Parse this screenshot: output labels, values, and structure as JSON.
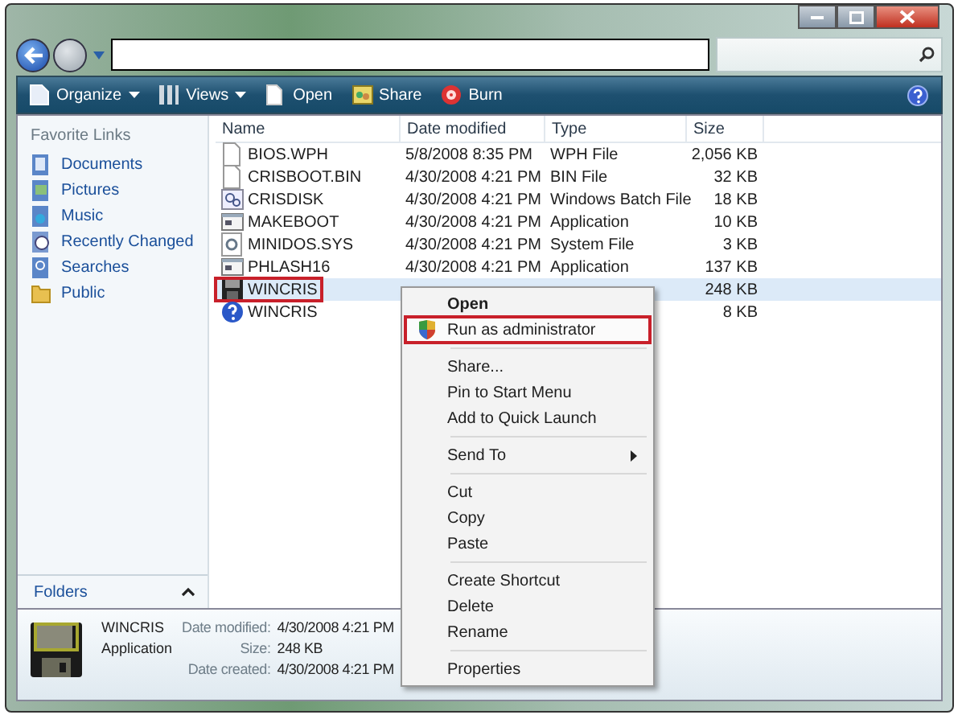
{
  "toolbar": [
    {
      "label": "Organize",
      "dropdown": true
    },
    {
      "label": "Views",
      "dropdown": true
    },
    {
      "label": "Open",
      "dropdown": false
    },
    {
      "label": "Share",
      "dropdown": false
    },
    {
      "label": "Burn",
      "dropdown": false
    }
  ],
  "sidebar": {
    "heading": "Favorite Links",
    "items": [
      {
        "label": "Documents"
      },
      {
        "label": "Pictures"
      },
      {
        "label": "Music"
      },
      {
        "label": "Recently Changed"
      },
      {
        "label": "Searches"
      },
      {
        "label": "Public"
      }
    ],
    "folders_label": "Folders"
  },
  "table": {
    "columns": [
      "Name",
      "Date modified",
      "Type",
      "Size"
    ],
    "rows": [
      {
        "kind": "blank",
        "name": "BIOS.WPH",
        "date": "5/8/2008 8:35 PM",
        "type": "WPH File",
        "size": "2,056 KB",
        "selected": false,
        "annotated": false
      },
      {
        "kind": "blank",
        "name": "CRISBOOT.BIN",
        "date": "4/30/2008 4:21 PM",
        "type": "BIN File",
        "size": "32 KB",
        "selected": false,
        "annotated": false
      },
      {
        "kind": "batch",
        "name": "CRISDISK",
        "date": "4/30/2008 4:21 PM",
        "type": "Windows Batch File",
        "size": "18 KB",
        "selected": false,
        "annotated": false
      },
      {
        "kind": "application",
        "name": "MAKEBOOT",
        "date": "4/30/2008 4:21 PM",
        "type": "Application",
        "size": "10 KB",
        "selected": false,
        "annotated": false
      },
      {
        "kind": "system",
        "name": "MINIDOS.SYS",
        "date": "4/30/2008 4:21 PM",
        "type": "System File",
        "size": "3 KB",
        "selected": false,
        "annotated": false
      },
      {
        "kind": "application",
        "name": "PHLASH16",
        "date": "4/30/2008 4:21 PM",
        "type": "Application",
        "size": "137 KB",
        "selected": false,
        "annotated": false
      },
      {
        "kind": "floppy",
        "name": "WINCRIS",
        "size": "248 KB",
        "selected": true,
        "annotated": true
      },
      {
        "kind": "help",
        "name": "WINCRIS",
        "size": "8 KB",
        "selected": false,
        "annotated": false
      }
    ]
  },
  "context_menu": {
    "groups": [
      [
        {
          "label": "Open",
          "default": true,
          "shield": false,
          "submenu": false,
          "annotated": false
        },
        {
          "label": "Run as administrator",
          "default": false,
          "shield": true,
          "submenu": false,
          "annotated": true
        }
      ],
      [
        {
          "label": "Share...",
          "default": false,
          "shield": false,
          "submenu": false,
          "annotated": false
        },
        {
          "label": "Pin to Start Menu",
          "default": false,
          "shield": false,
          "submenu": false,
          "annotated": false
        },
        {
          "label": "Add to Quick Launch",
          "default": false,
          "shield": false,
          "submenu": false,
          "annotated": false
        }
      ],
      [
        {
          "label": "Send To",
          "default": false,
          "shield": false,
          "submenu": true,
          "annotated": false
        }
      ],
      [
        {
          "label": "Cut",
          "default": false,
          "shield": false,
          "submenu": false,
          "annotated": false
        },
        {
          "label": "Copy",
          "default": false,
          "shield": false,
          "submenu": false,
          "annotated": false
        },
        {
          "label": "Paste",
          "default": false,
          "shield": false,
          "submenu": false,
          "annotated": false
        }
      ],
      [
        {
          "label": "Create Shortcut",
          "default": false,
          "shield": false,
          "submenu": false,
          "annotated": false
        },
        {
          "label": "Delete",
          "default": false,
          "shield": false,
          "submenu": false,
          "annotated": false
        },
        {
          "label": "Rename",
          "default": false,
          "shield": false,
          "submenu": false,
          "annotated": false
        }
      ],
      [
        {
          "label": "Properties",
          "default": false,
          "shield": false,
          "submenu": false,
          "annotated": false
        }
      ]
    ]
  },
  "details": {
    "name": "WINCRIS",
    "type": "Application",
    "fields": [
      {
        "label": "Date modified:",
        "value": "4/30/2008 4:21 PM"
      },
      {
        "label": "Size:",
        "value": "248 KB"
      },
      {
        "label": "Date created:",
        "value": "4/30/2008 4:21 PM"
      }
    ]
  }
}
